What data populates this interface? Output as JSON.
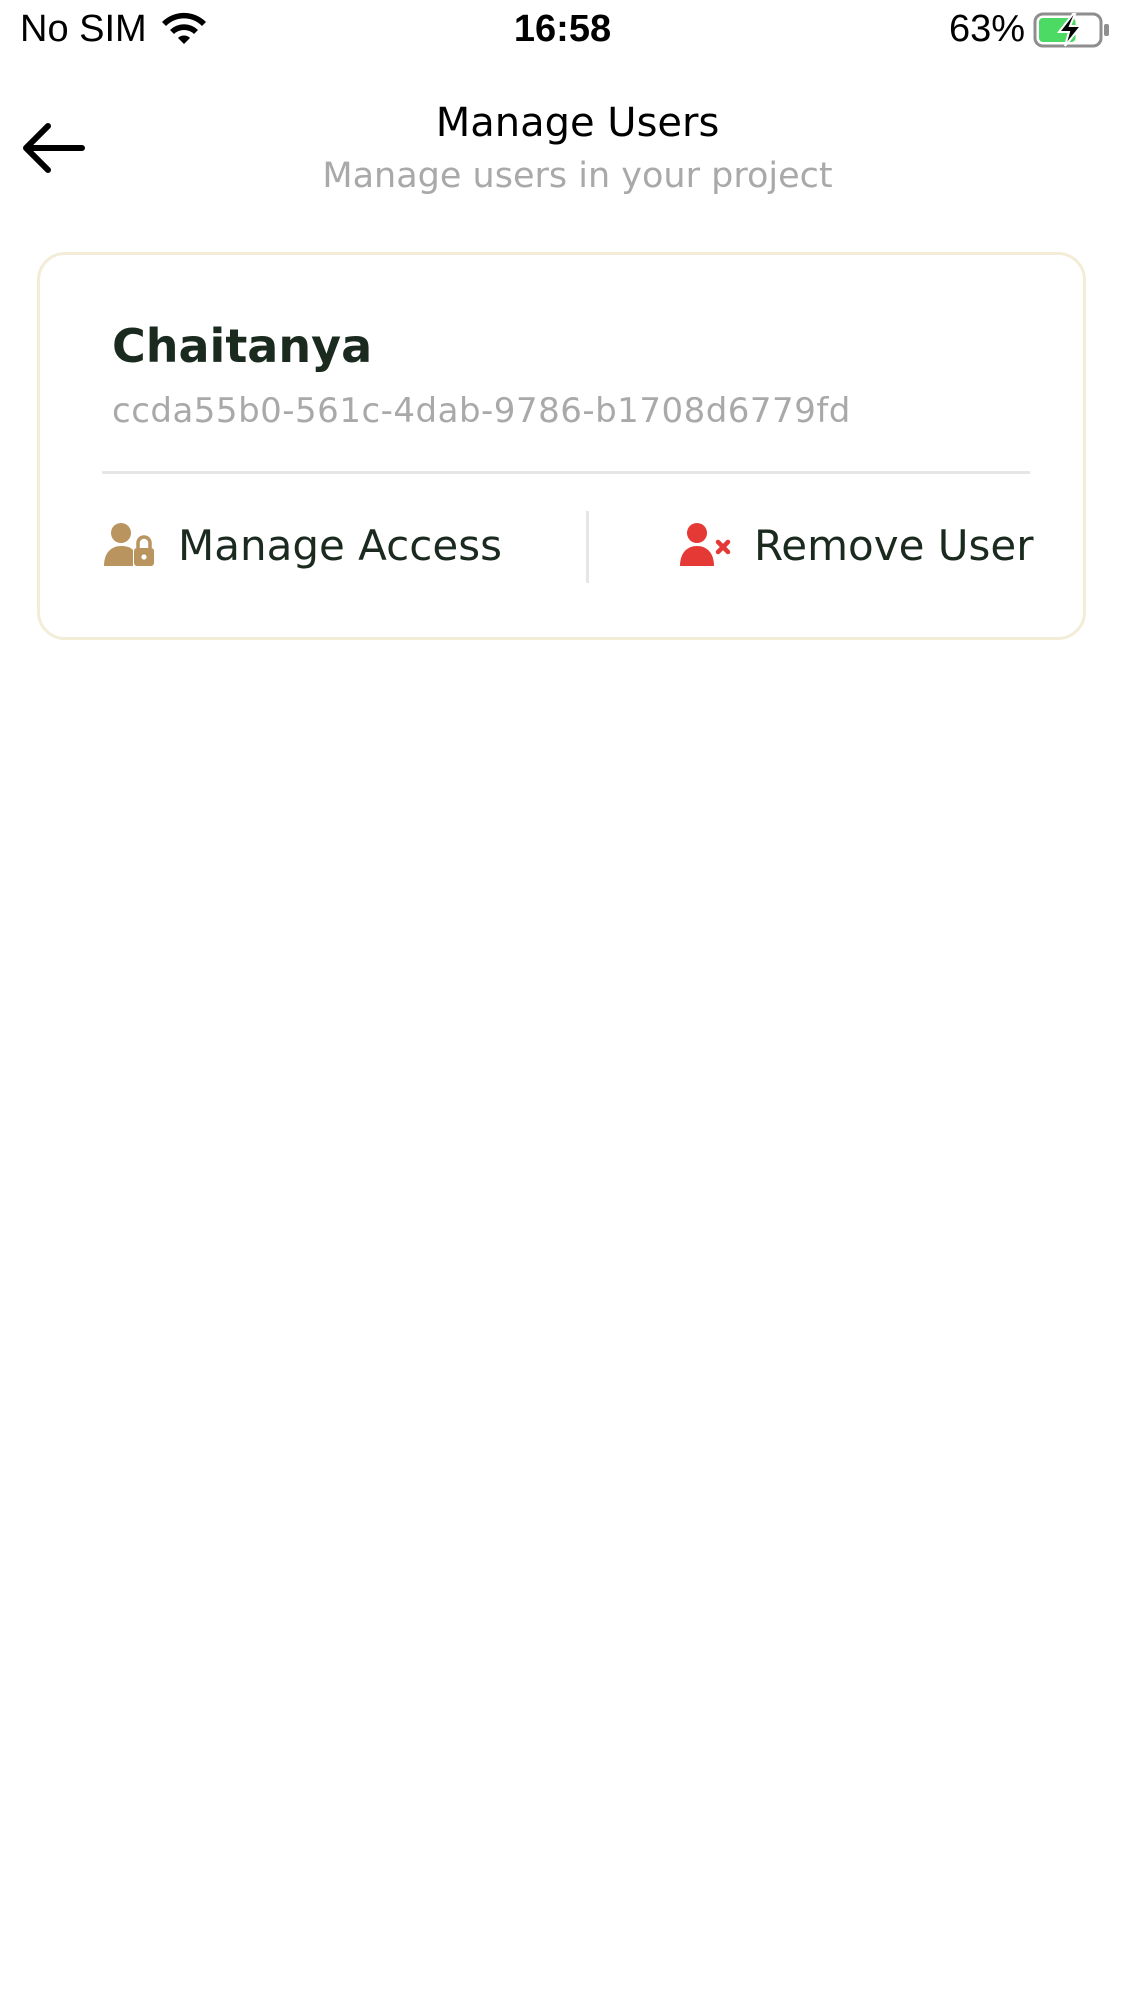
{
  "status_bar": {
    "carrier": "No SIM",
    "time": "16:58",
    "battery_percent": "63%",
    "battery_level": 0.63,
    "charging": true,
    "battery_color": "#4cd964"
  },
  "header": {
    "back_icon": "arrow-left-icon",
    "title": "Manage Users",
    "subtitle": "Manage users in your project"
  },
  "users": [
    {
      "name": "Chaitanya",
      "id": "ccda55b0-561c-4dab-9786-b1708d6779fd",
      "actions": {
        "manage_access": {
          "label": "Manage Access",
          "icon": "user-lock-icon",
          "icon_color": "#b9945f"
        },
        "remove_user": {
          "label": "Remove User",
          "icon": "user-remove-icon",
          "icon_color": "#e53935"
        }
      }
    }
  ],
  "colors": {
    "card_border": "#f3ecd7",
    "text_primary": "#1b2a1f",
    "text_muted": "#a9a9a9",
    "divider": "#e6e6e6"
  }
}
